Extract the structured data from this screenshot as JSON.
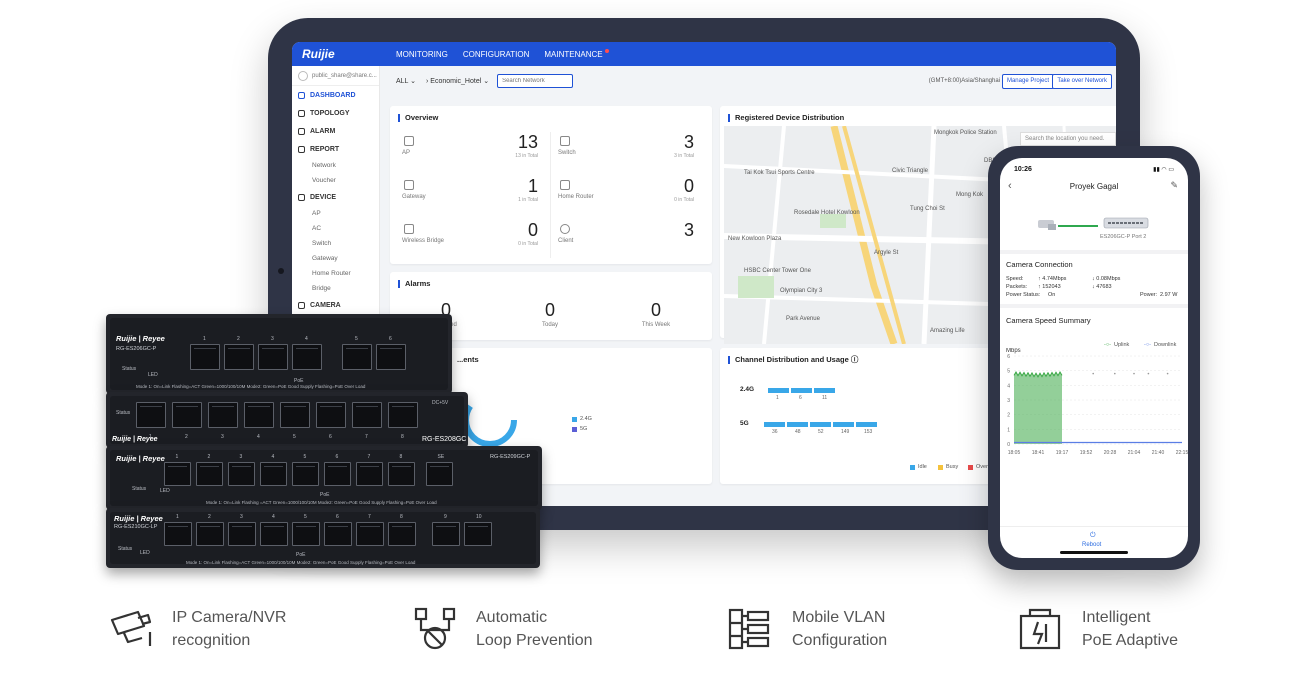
{
  "app": {
    "brand": "Ruijie",
    "nav": [
      "MONITORING",
      "CONFIGURATION",
      "MAINTENANCE"
    ]
  },
  "sidebar": {
    "user": "public_share@share.c...",
    "items": [
      {
        "label": "DASHBOARD",
        "active": true
      },
      {
        "label": "TOPOLOGY"
      },
      {
        "label": "ALARM"
      },
      {
        "label": "REPORT",
        "sub": [
          "Network",
          "Voucher"
        ]
      },
      {
        "label": "DEVICE",
        "sub": [
          "AP",
          "AC",
          "Switch",
          "Gateway",
          "Home Router",
          "Bridge"
        ]
      },
      {
        "label": "CAMERA"
      }
    ]
  },
  "toolbar": {
    "all": "ALL",
    "site": "Economic_Hotel",
    "search_placeholder": "Search Network",
    "timezone": "(GMT+8:00)Asia/Shanghai",
    "manage": "Manage Project",
    "take_over": "Take over Network"
  },
  "overview": {
    "title": "Overview",
    "cells": [
      {
        "label": "AP",
        "value": "13",
        "total": "13 in Total",
        "icon": "ap-icon"
      },
      {
        "label": "Switch",
        "value": "3",
        "total": "3 in Total",
        "icon": "switch-icon"
      },
      {
        "label": "Gateway",
        "value": "1",
        "total": "1 in Total",
        "icon": "gateway-icon"
      },
      {
        "label": "Home Router",
        "value": "0",
        "total": "0 in Total",
        "icon": "router-icon"
      },
      {
        "label": "Wireless Bridge",
        "value": "0",
        "total": "0 in Total",
        "icon": "bridge-icon"
      },
      {
        "label": "Client",
        "value": "3",
        "total": "",
        "icon": "client-icon"
      }
    ]
  },
  "alarms": {
    "title": "Alarms",
    "cells": [
      {
        "value": "0",
        "label": "...leared"
      },
      {
        "value": "0",
        "label": "Today"
      },
      {
        "value": "0",
        "label": "This Week"
      }
    ]
  },
  "map": {
    "title": "Registered Device Distribution",
    "search_placeholder": "Search the location you need.",
    "labels": [
      "Mongkok Police Station",
      "DBS Roadshow",
      "Tai Kok Tsui Sports Centre",
      "Civic Triangle",
      "Mong Kok",
      "Rosedale Hotel Kowloon",
      "Tung Choi St",
      "New Kowloon Plaza",
      "Argyle St",
      "HSBC Center Tower One",
      "Olympian City 3",
      "Park Avenue",
      "Amazing Life"
    ]
  },
  "clients_card": {
    "title": "...ents",
    "legend": [
      "2.4G",
      "5G"
    ]
  },
  "channel": {
    "title": "Channel Distribution and Usage",
    "rows": [
      {
        "band": "2.4G",
        "channels": [
          "1",
          "6",
          "11"
        ]
      },
      {
        "band": "5G",
        "channels": [
          "36",
          "48",
          "52",
          "149",
          "153"
        ]
      }
    ],
    "legend": [
      "Idle",
      "Busy",
      "Over..."
    ],
    "colors": {
      "idle": "#39a7e8",
      "busy": "#f5c23c",
      "over": "#e84a4a"
    }
  },
  "switches": [
    {
      "brand": "Ruijie | Reyee",
      "model": "RG-ES206GC-P",
      "status": "Status",
      "led": "LED",
      "ports": [
        "1",
        "2",
        "3",
        "4",
        "5",
        "6"
      ],
      "note": "Mode 1: On=Link Flashing=ACT  Green=1000/100/10M  Mode2: Green=PoE Good Supply  Flashing=PoE Over Load",
      "poe": "PoE"
    },
    {
      "brand": "Ruijie | Reyee",
      "model": "RG-ES208GC",
      "status": "Status",
      "power": "DC+5V",
      "ports": [
        "1",
        "2",
        "3",
        "4",
        "5",
        "6",
        "7",
        "8"
      ]
    },
    {
      "brand": "Ruijie | Reyee",
      "model": "RG-ES209GC-P",
      "status": "Status",
      "led": "LED",
      "ports": [
        "1",
        "2",
        "3",
        "4",
        "5",
        "6",
        "7",
        "8",
        "SE"
      ],
      "note": "Mode 1: On=Link Flashing =ACT  Green=1000/100/10M  Mode2: Green=PoE Good Supply  Flashing=PoE Over Load",
      "poe": "PoE"
    },
    {
      "brand": "Ruijie | Reyee",
      "model": "RG-ES210GC-LP",
      "status": "Status",
      "led": "LED",
      "ports": [
        "1",
        "2",
        "3",
        "4",
        "5",
        "6",
        "7",
        "8",
        "9",
        "10"
      ],
      "note": "Mode 1: On=Link Flashing=ACT  Green=1000/100/10M  Mode2: Green=PoE Good Supply  Flashing=PoE Over Load",
      "poe": "PoE"
    }
  ],
  "phone": {
    "time": "10:26",
    "title": "Proyek Gagal",
    "device": "ES206GC-P Port 2",
    "connection_title": "Camera Connection",
    "speed_label": "Speed:",
    "speed_up": "4.74Mbps",
    "speed_down": "0.08Mbps",
    "packets_label": "Packets:",
    "packets_up": "152043",
    "packets_down": "47683",
    "power_status_label": "Power Status:",
    "power_status": "On",
    "power_label": "Power:",
    "power": "2.97 W",
    "summary_title": "Camera Speed Summary",
    "unit": "Mbps",
    "legend": [
      "Uplink",
      "Downlink"
    ],
    "reboot": "Reboot"
  },
  "chart_data": {
    "type": "area",
    "ylabel": "Mbps",
    "x": [
      "18:05",
      "18:41",
      "19:17",
      "19:52",
      "20:28",
      "21:04",
      "21:40",
      "22:15"
    ],
    "ylim": [
      0,
      6
    ],
    "y_ticks": [
      "0",
      "1",
      "2",
      "3",
      "4",
      "5",
      "6"
    ],
    "series": [
      {
        "name": "Uplink",
        "values": [
          4.8,
          4.7,
          4.8,
          null,
          null,
          null,
          null,
          null
        ],
        "color": "#3aa845"
      },
      {
        "name": "Downlink",
        "values": [
          0.1,
          0.1,
          0.1,
          0.1,
          0.1,
          0.1,
          0.1,
          0.1
        ],
        "color": "#5b7ee5"
      }
    ],
    "grid": true,
    "legend": "top-right"
  },
  "features": [
    {
      "line1": "IP Camera/NVR",
      "line2": "recognition",
      "icon": "ip-camera-icon"
    },
    {
      "line1": "Automatic",
      "line2": "Loop Prevention",
      "icon": "loop-prevention-icon"
    },
    {
      "line1": "Mobile VLAN",
      "line2": "Configuration",
      "icon": "vlan-icon"
    },
    {
      "line1": "Intelligent",
      "line2": "PoE Adaptive",
      "icon": "poe-adaptive-icon"
    }
  ]
}
